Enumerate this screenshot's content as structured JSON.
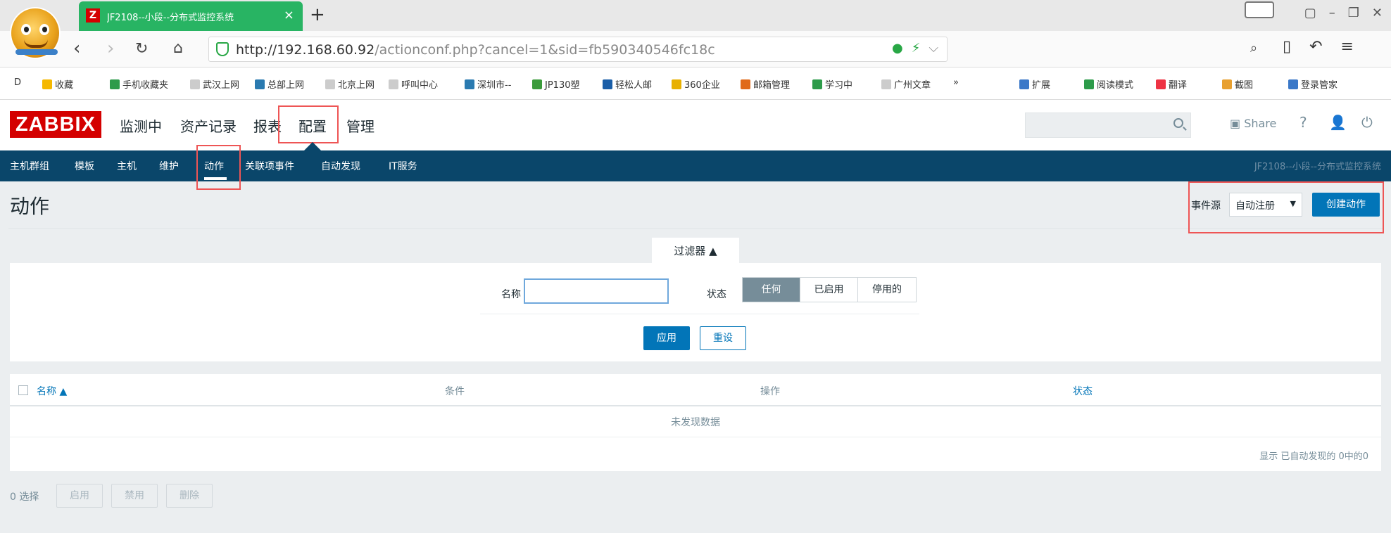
{
  "browser": {
    "tab_favicon": "Z",
    "tab_title": "JF2108--小段--分布式监控系统",
    "new_tab": "+",
    "url_host": "http://192.168.60.92",
    "url_path": "/actionconf.php?cancel=1&sid=fb590340546fc18c",
    "bookmarks": [
      "收藏",
      "手机收藏夹",
      "武汉上网",
      "总部上网",
      "北京上网",
      "呼叫中心",
      "深圳市--",
      "JP130塑",
      "轻松人邮",
      "360企业",
      "邮箱管理",
      "学习中",
      "广州文章",
      "扩展",
      "阅读模式",
      "翻译",
      "截图",
      "登录管家"
    ]
  },
  "header": {
    "logo": "ZABBIX",
    "menu": [
      "监测中",
      "资产记录",
      "报表",
      "配置",
      "管理"
    ],
    "share": "Share",
    "help": "?"
  },
  "subnav": {
    "items": [
      "主机群组",
      "模板",
      "主机",
      "维护",
      "动作",
      "关联项事件",
      "自动发现",
      "IT服务"
    ],
    "right_text": "JF2108--小段--分布式监控系统"
  },
  "page": {
    "title": "动作",
    "event_source_label": "事件源",
    "event_source_value": "自动注册",
    "create_button": "创建动作"
  },
  "filter": {
    "tab_label": "过滤器 ▲",
    "name_label": "名称",
    "status_label": "状态",
    "status_options": [
      "任何",
      "已启用",
      "停用的"
    ],
    "status_selected": "任何",
    "apply": "应用",
    "reset": "重设"
  },
  "table": {
    "columns": [
      "名称 ▲",
      "条件",
      "操作",
      "状态"
    ],
    "empty_text": "未发现数据",
    "footer": "显示 已自动发现的 0中的0"
  },
  "bottom": {
    "selected": "0 选择",
    "buttons": [
      "启用",
      "禁用",
      "删除"
    ]
  }
}
